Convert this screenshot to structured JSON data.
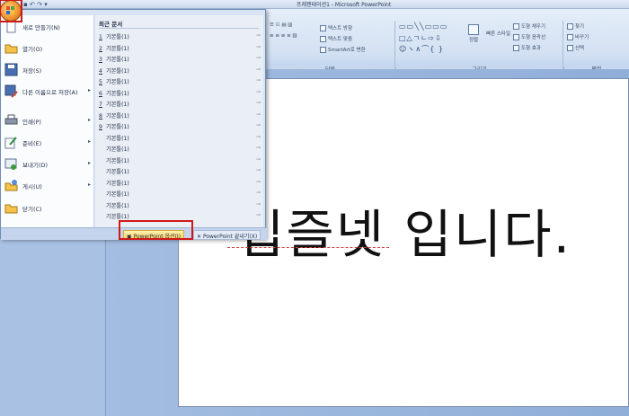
{
  "window": {
    "title": "프레젠테이션1 - Microsoft PowerPoint"
  },
  "quick_access": {
    "icons": [
      "save-icon",
      "undo-icon",
      "redo-icon",
      "customize-icon"
    ]
  },
  "ribbon": {
    "groups": [
      {
        "id": "paragraph",
        "label": "단락",
        "buttons": [
          "텍스트 방향",
          "텍스트 맞춤",
          "SmartArt로 변환"
        ]
      },
      {
        "id": "drawing",
        "label": "그리기",
        "buttons": [
          "정렬",
          "빠른 스타일",
          "도형 채우기",
          "도형 윤곽선",
          "도형 효과"
        ]
      },
      {
        "id": "editing",
        "label": "편집",
        "buttons": [
          "찾기",
          "바꾸기",
          "선택"
        ]
      }
    ]
  },
  "office_menu": {
    "left_items": [
      {
        "label": "새로 만들기(N)",
        "icon": "new-document-icon",
        "submenu": false
      },
      {
        "label": "열기(O)",
        "icon": "open-folder-icon",
        "submenu": false
      },
      {
        "label": "저장(S)",
        "icon": "save-icon",
        "submenu": false
      },
      {
        "label": "다른 이름으로 저장(A)",
        "icon": "save-as-icon",
        "submenu": true
      },
      {
        "label": "인쇄(P)",
        "icon": "print-icon",
        "submenu": true
      },
      {
        "label": "준비(E)",
        "icon": "prepare-icon",
        "submenu": true
      },
      {
        "label": "보내기(D)",
        "icon": "send-icon",
        "submenu": true
      },
      {
        "label": "게시(U)",
        "icon": "publish-icon",
        "submenu": true
      },
      {
        "label": "닫기(C)",
        "icon": "close-folder-icon",
        "submenu": false
      }
    ],
    "recent_header": "최근 문서",
    "recent_docs": [
      {
        "num": "1",
        "name": "기본틀(1)"
      },
      {
        "num": "2",
        "name": "기본틀(1)"
      },
      {
        "num": "3",
        "name": "기본틀(1)"
      },
      {
        "num": "4",
        "name": "기본틀(1)"
      },
      {
        "num": "5",
        "name": "기본틀(1)"
      },
      {
        "num": "6",
        "name": "기본틀(1)"
      },
      {
        "num": "7",
        "name": "기본틀(1)"
      },
      {
        "num": "8",
        "name": "기본틀(1)"
      },
      {
        "num": "9",
        "name": "기본틀(1)"
      },
      {
        "num": "",
        "name": "기본틀(1)"
      },
      {
        "num": "",
        "name": "기본틀(1)"
      },
      {
        "num": "",
        "name": "기본틀(1)"
      },
      {
        "num": "",
        "name": "기본틀(1)"
      },
      {
        "num": "",
        "name": "기본틀(1)"
      },
      {
        "num": "",
        "name": "기본틀(1)"
      },
      {
        "num": "",
        "name": "기본틀(1)"
      },
      {
        "num": "",
        "name": "기본틀(1)"
      }
    ],
    "options_label": "PowerPoint 옵션(I)",
    "exit_label": "PowerPoint 끝내기(X)"
  },
  "slide": {
    "text": "입즐넷 입니다."
  },
  "colors": {
    "highlight_box": "#d01818",
    "menu_bg": "#d9e4f3",
    "ribbon_bg": "#d3e1f3"
  }
}
